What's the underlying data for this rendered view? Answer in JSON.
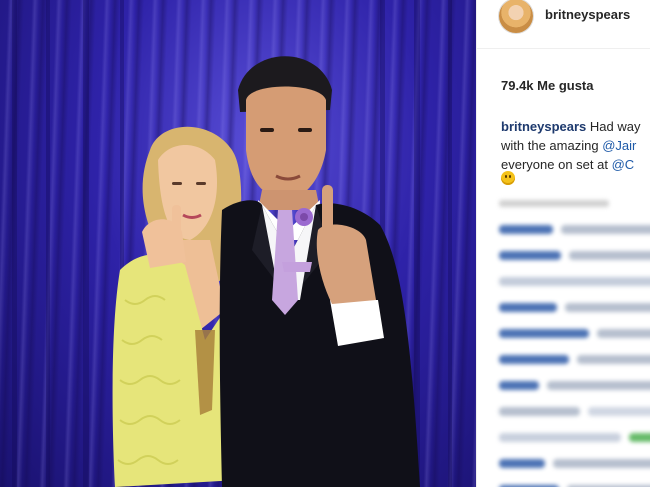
{
  "post": {
    "username": "britneyspears",
    "likes": "79.4k Me gusta",
    "caption": {
      "username": "britneyspears",
      "line1_text": "Had way",
      "line2_text": "with the amazing",
      "line2_mention": "@Jair",
      "line3_text": "everyone on set at",
      "line3_mention": "@C"
    }
  },
  "colors": {
    "background_curtain": "#2e22a8",
    "dress": "#e9e87a",
    "suit": "#0f0f15",
    "tie": "#c9a8e0",
    "username_link": "#1e3a6e"
  },
  "icons": {
    "emoji": "grinning-face-icon"
  }
}
